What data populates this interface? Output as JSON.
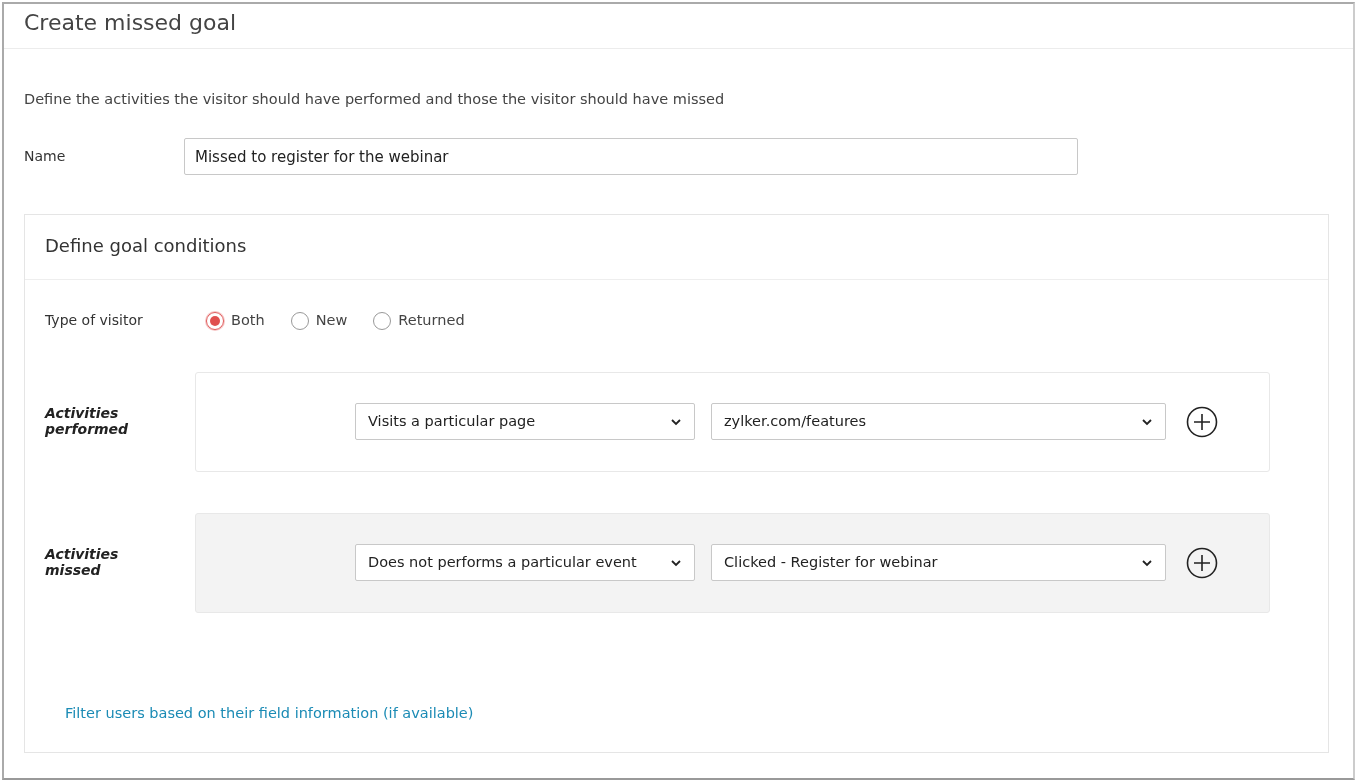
{
  "title": "Create missed goal",
  "description": "Define the activities the visitor should have performed and those the visitor should have missed",
  "name_field": {
    "label": "Name",
    "value": "Missed to register for the webinar"
  },
  "conditions": {
    "title": "Define goal conditions",
    "visitor_type": {
      "label": "Type of visitor",
      "options": [
        {
          "label": "Both",
          "selected": true
        },
        {
          "label": "New",
          "selected": false
        },
        {
          "label": "Returned",
          "selected": false
        }
      ]
    },
    "activity_groups": [
      {
        "label": "Activities performed",
        "shaded": false,
        "selects": [
          "Visits a particular page",
          "zylker.com/features"
        ]
      },
      {
        "label": "Activities missed",
        "shaded": true,
        "selects": [
          "Does not performs a particular event",
          "Clicked - Register for webinar"
        ]
      }
    ],
    "filter_link": "Filter users based on their field information (if available)"
  }
}
